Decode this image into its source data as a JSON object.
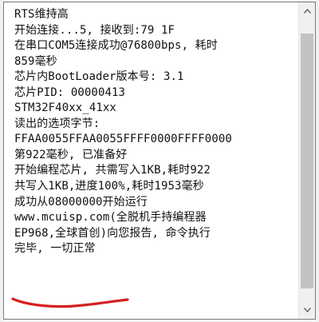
{
  "log": {
    "lines": [
      "RTS维持高",
      "开始连接...5, 接收到:79 1F",
      "在串口COM5连接成功@76800bps, 耗时",
      "859毫秒",
      "芯片内BootLoader版本号: 3.1",
      "芯片PID: 00000413",
      "STM32F40xx_41xx",
      "读出的选项字节:",
      "FFAA0055FFAA0055FFFF0000FFFF0000",
      "第922毫秒, 已准备好",
      "开始编程芯片, 共需写入1KB,耗时922",
      "共写入1KB,进度100%,耗时1953毫秒",
      "成功从08000000开始运行",
      "www.mcuisp.com(全脱机手持编程器",
      "EP968,全球首创)向您报告, 命令执行",
      "完毕, 一切正常"
    ]
  },
  "scrollbar": {
    "position": 0.5,
    "visible_fraction": 0.9,
    "up_icon": "triangle-up",
    "down_icon": "triangle-down",
    "thumb_color": "#c2c2c2",
    "track_color": "#f0f0f0"
  },
  "annotation": {
    "color": "#d62020",
    "shape": "hand-drawn underline under last line"
  }
}
